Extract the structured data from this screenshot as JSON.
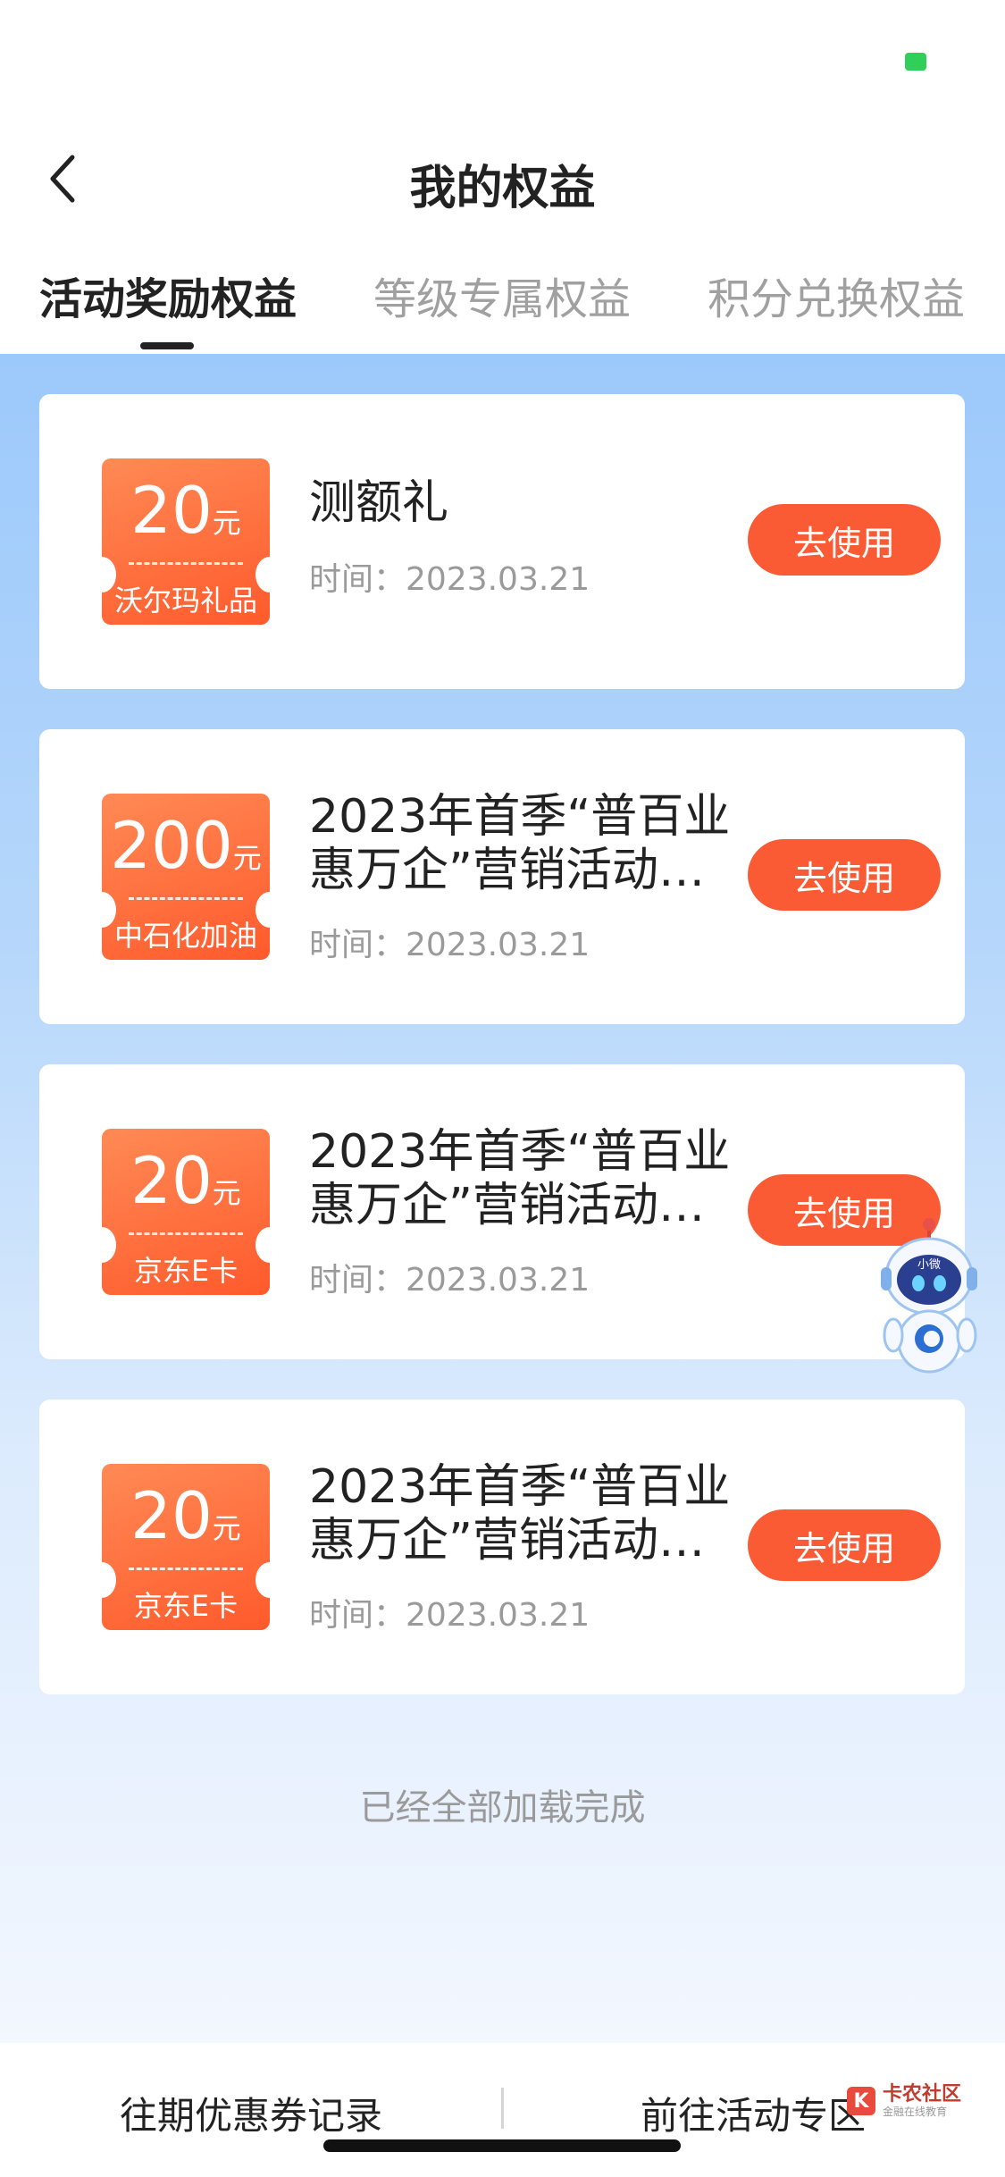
{
  "header": {
    "title": "我的权益"
  },
  "tabs": [
    {
      "label": "活动奖励权益",
      "active": true
    },
    {
      "label": "等级专属权益",
      "active": false
    },
    {
      "label": "积分兑换权益",
      "active": false
    }
  ],
  "cards": [
    {
      "amount": "20",
      "unit": "元",
      "brand": "沃尔玛礼品",
      "title": "测额礼",
      "date": "时间：2023.03.21",
      "button": "去使用"
    },
    {
      "amount": "200",
      "unit": "元",
      "brand": "中石化加油",
      "title": "2023年首季“普百业惠万企”营销活动…",
      "date": "时间：2023.03.21",
      "button": "去使用"
    },
    {
      "amount": "20",
      "unit": "元",
      "brand": "京东E卡",
      "title": "2023年首季“普百业惠万企”营销活动…",
      "date": "时间：2023.03.21",
      "button": "去使用"
    },
    {
      "amount": "20",
      "unit": "元",
      "brand": "京东E卡",
      "title": "2023年首季“普百业惠万企”营销活动…",
      "date": "时间：2023.03.21",
      "button": "去使用"
    }
  ],
  "footer_note": "已经全部加载完成",
  "bottom_bar": {
    "left_link": "往期优惠券记录",
    "right_link": "前往活动专区"
  },
  "robot_badge": "小微",
  "watermark": {
    "logo_text": "K",
    "title": "卡农社区",
    "subtitle": "金融在线教育"
  },
  "colors": {
    "accent": "#fa5a34",
    "coupon_top": "#ff8a55",
    "coupon_bottom": "#ff5a2c",
    "background_top": "#9cc9fb",
    "background_bottom": "#f3f7fe",
    "status_icon": "#2fd05a"
  }
}
